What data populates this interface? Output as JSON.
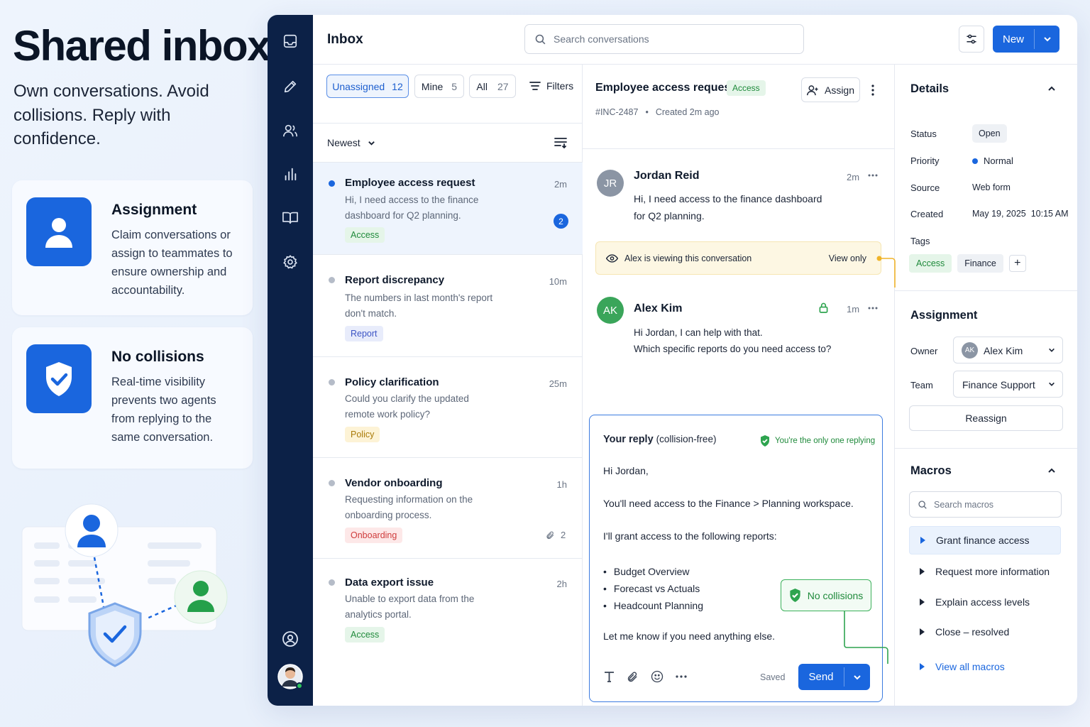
{
  "hero": {
    "title": "Shared inbox",
    "subtitle": "Own conversations. Avoid collisions. Reply with confidence."
  },
  "features": [
    {
      "title": "Assignment",
      "text": "Claim conversations or assign to teammates to ensure ownership and accountability.",
      "icon": "user-icon"
    },
    {
      "title": "No collisions",
      "text": "Real-time visibility prevents two agents from replying to the same conversation.",
      "icon": "shield-check-icon"
    }
  ],
  "rail": {
    "icons": [
      "inbox-icon",
      "compose-icon",
      "team-icon",
      "reports-icon",
      "knowledge-icon",
      "settings-icon",
      "help-icon",
      "profile-avatar"
    ]
  },
  "topbar": {
    "title": "Inbox",
    "search_placeholder": "Search conversations",
    "new_label": "New"
  },
  "filters": {
    "tabs": [
      {
        "label": "Unassigned",
        "count": "12",
        "active": true
      },
      {
        "label": "Mine",
        "count": "5",
        "active": false
      },
      {
        "label": "All",
        "count": "27",
        "active": false
      }
    ],
    "filters_label": "Filters",
    "sort_label": "Newest"
  },
  "conversations": [
    {
      "title": "Employee access request",
      "time": "2m",
      "preview": "Hi, I need access to the finance dashboard for Q2 planning.",
      "tag": "Access",
      "tag_style": "green",
      "unread": "2",
      "selected": true
    },
    {
      "title": "Report discrepancy",
      "time": "10m",
      "preview": "The numbers in last month's report don't match.",
      "tag": "Report",
      "tag_style": "blue"
    },
    {
      "title": "Policy clarification",
      "time": "25m",
      "preview": "Could you clarify the updated remote work policy?",
      "tag": "Policy",
      "tag_style": "yellow"
    },
    {
      "title": "Vendor onboarding",
      "time": "1h",
      "preview": "Requesting information on the onboarding process.",
      "tag": "Onboarding",
      "tag_style": "red",
      "attachments": "2"
    },
    {
      "title": "Data export issue",
      "time": "2h",
      "preview": "Unable to export data from the analytics portal.",
      "tag": "Access",
      "tag_style": "green"
    }
  ],
  "conversation": {
    "title": "Employee access request",
    "tag": "Access",
    "id": "#INC-2487",
    "created": "Created 2m ago",
    "assign_label": "Assign",
    "messages": [
      {
        "initials": "JR",
        "author": "Jordan Reid",
        "time": "2m",
        "lines": [
          "Hi, I need access to the finance dashboard",
          "for Q2 planning."
        ]
      },
      {
        "initials": "AK",
        "author": "Alex Kim",
        "time": "1m",
        "lines": [
          "Hi Jordan, I can help with that.",
          "Which specific reports do you need access to?"
        ]
      }
    ],
    "viewing_notice": "Alex is viewing this conversation",
    "view_only_label": "View only"
  },
  "reply": {
    "heading": "Your reply",
    "heading_note": "(collision-free)",
    "status": "You're the only one replying",
    "greeting": "Hi Jordan,",
    "line1": "You'll need access to the Finance > Planning workspace.",
    "line2": "I'll grant access to the following reports:",
    "bullets": [
      "Budget Overview",
      "Forecast vs Actuals",
      "Headcount Planning"
    ],
    "closing": "Let me know if you need anything else.",
    "no_collisions": "No collisions",
    "saved": "Saved",
    "send": "Send"
  },
  "details": {
    "heading": "Details",
    "rows": [
      {
        "label": "Status",
        "value": "Open"
      },
      {
        "label": "Priority",
        "value": "Normal"
      },
      {
        "label": "Source",
        "value": "Web form"
      },
      {
        "label": "Created",
        "value": "May 19, 2025  10:15 AM"
      }
    ],
    "tags_label": "Tags",
    "tags": [
      "Access",
      "Finance"
    ]
  },
  "assignment": {
    "heading": "Assignment",
    "owner_label": "Owner",
    "owner_initials": "AK",
    "owner": "Alex Kim",
    "team_label": "Team",
    "team": "Finance Support",
    "reassign": "Reassign"
  },
  "macros": {
    "heading": "Macros",
    "search_placeholder": "Search macros",
    "items": [
      "Grant finance access",
      "Request more information",
      "Explain access levels",
      "Close – resolved"
    ],
    "view_all": "View all macros"
  },
  "colors": {
    "primary": "#1a66de",
    "rail": "#0c2147",
    "success": "#1f9d4a",
    "warning_bg": "#fdf7e3"
  }
}
